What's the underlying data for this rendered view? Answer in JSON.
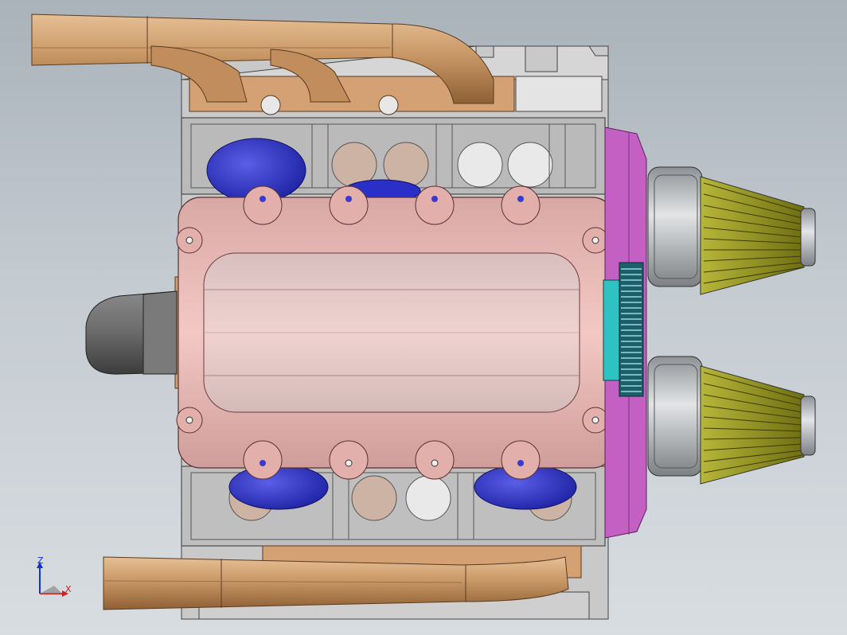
{
  "viewport": {
    "background": "#c4cbd1",
    "model": "v8-engine-assembly",
    "view": "top"
  },
  "triad": {
    "z_label": "Z",
    "x_label": "X",
    "z_color": "#1133cc",
    "x_color": "#cc2222"
  },
  "colors": {
    "exhaust": "#c99866",
    "head": "#cfcfcf",
    "crankcase": "#eab8b4",
    "piston": "#2a2fc8",
    "timing_cover": "#c45fc4",
    "pulley": "#2ec2c2",
    "air_filter": "#8c8c1a",
    "flywheel": "#5a5a5a"
  }
}
